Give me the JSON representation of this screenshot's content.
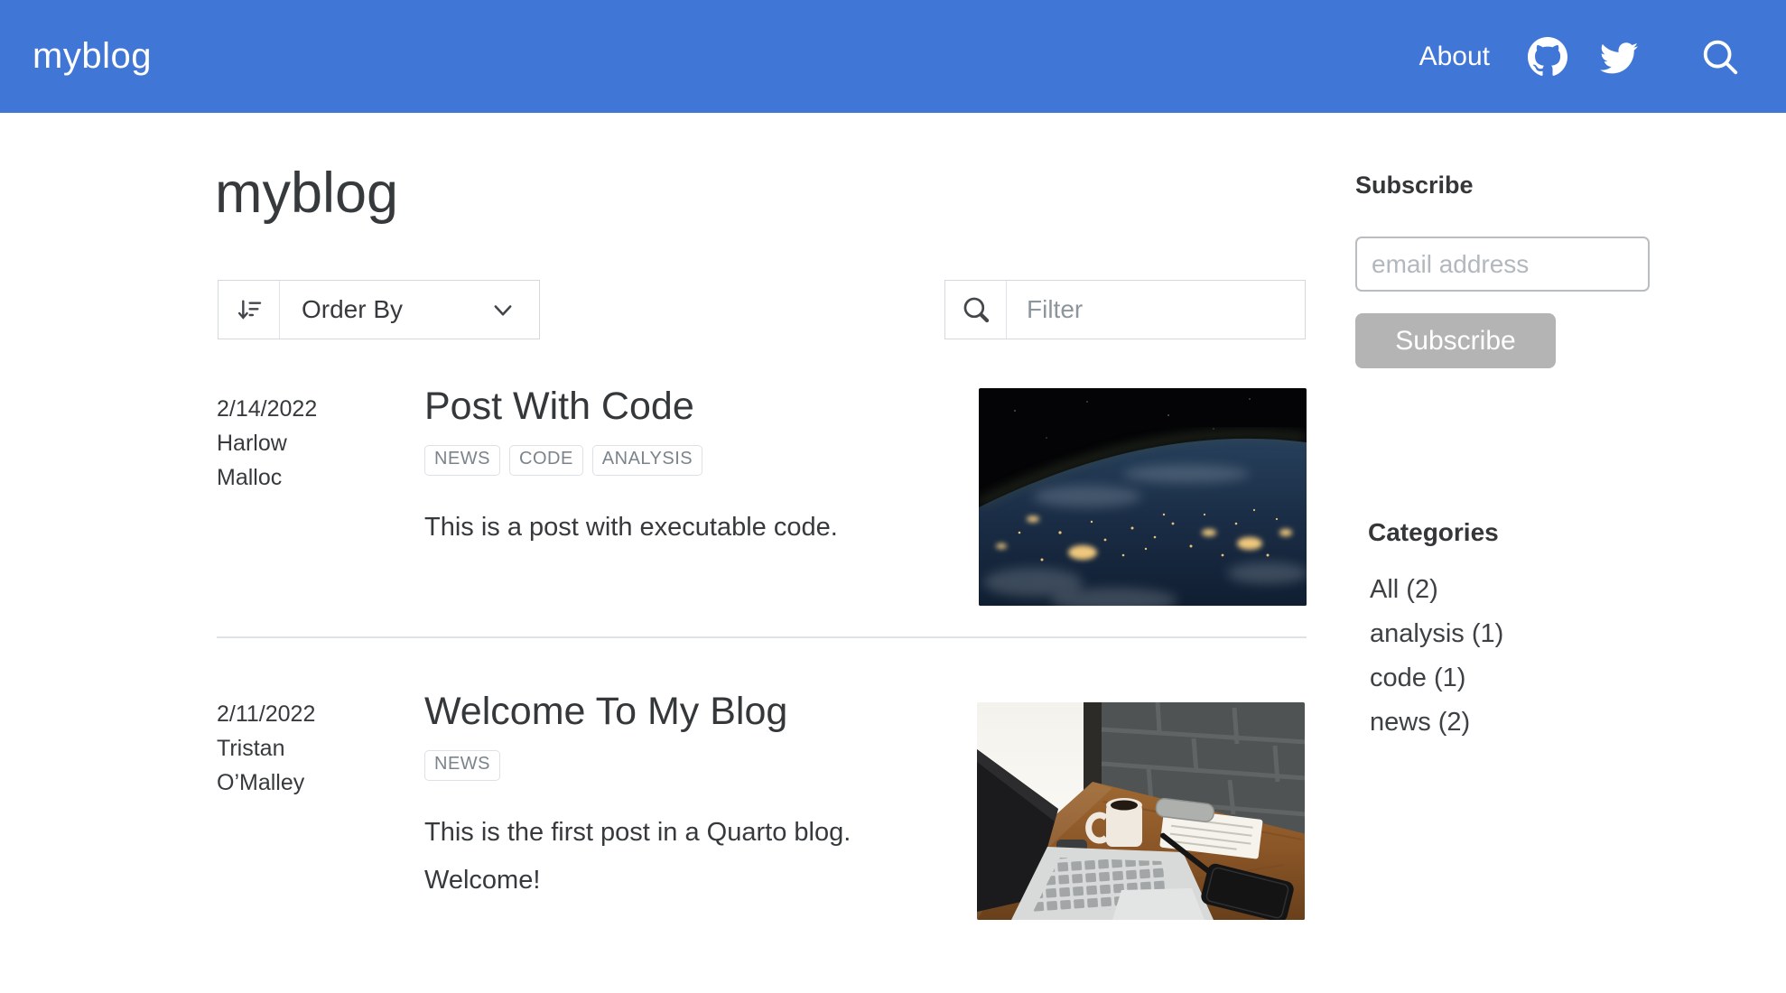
{
  "navbar": {
    "brand": "myblog",
    "about_label": "About",
    "bg_color": "#4076d6",
    "icons": [
      "github-icon",
      "twitter-icon",
      "search-icon"
    ]
  },
  "page": {
    "title": "myblog"
  },
  "toolbar": {
    "order_by_label": "Order By",
    "filter_placeholder": "Filter",
    "filter_value": ""
  },
  "posts": [
    {
      "date": "2/14/2022",
      "author": "Harlow Malloc",
      "title": "Post With Code",
      "tags": [
        "NEWS",
        "CODE",
        "ANALYSIS"
      ],
      "description": "This is a post with executable code.",
      "image": "earth-at-night-from-space"
    },
    {
      "date": "2/11/2022",
      "author": "Tristan O’Malley",
      "title": "Welcome To My Blog",
      "tags": [
        "NEWS"
      ],
      "description": "This is the first post in a Quarto blog. Welcome!",
      "image": "desk-with-laptop-and-coffee"
    }
  ],
  "sidebar": {
    "subscribe": {
      "heading": "Subscribe",
      "email_placeholder": "email address",
      "email_value": "",
      "button_label": "Subscribe",
      "button_color": "#b4b4b4"
    },
    "categories": {
      "heading": "Categories",
      "items": [
        {
          "label": "All (2)"
        },
        {
          "label": "analysis (1)"
        },
        {
          "label": "code (1)"
        },
        {
          "label": "news (2)"
        }
      ]
    }
  }
}
